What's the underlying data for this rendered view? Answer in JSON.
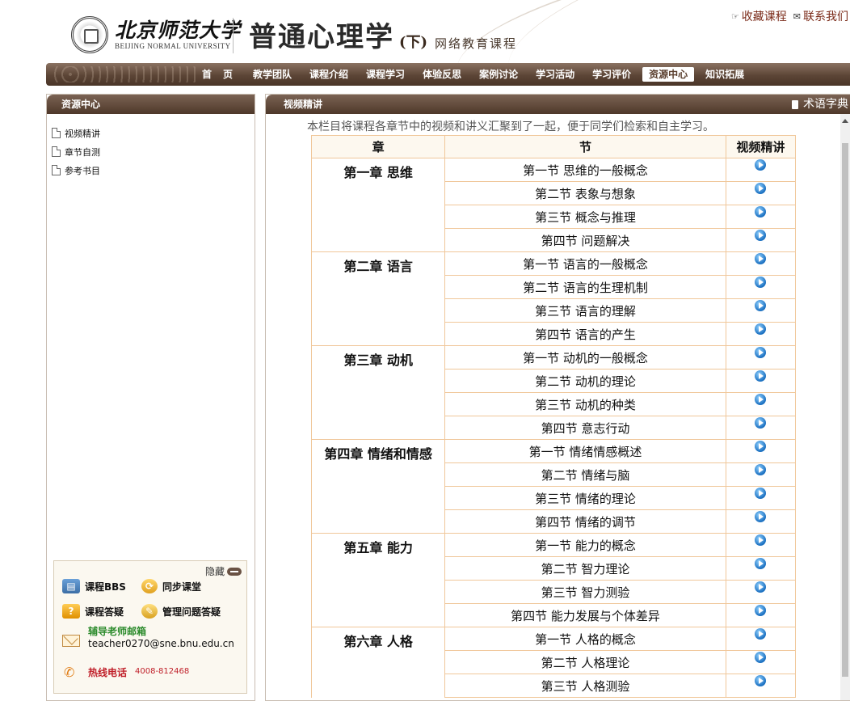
{
  "header": {
    "university_cn": "北京师范大学",
    "university_en": "BEIJING NORMAL UNIVERSITY",
    "course_title": "普通心理学",
    "course_part": "(下)",
    "course_tag": "网络教育课程",
    "links": [
      {
        "label": "收藏课程",
        "icon": "bookmark-icon"
      },
      {
        "label": "联系我们",
        "icon": "mail-icon"
      }
    ]
  },
  "nav": {
    "items": [
      {
        "label": "首页",
        "key": "home"
      },
      {
        "label": "教学团队",
        "key": "team"
      },
      {
        "label": "课程介绍",
        "key": "intro"
      },
      {
        "label": "课程学习",
        "key": "study"
      },
      {
        "label": "体验反思",
        "key": "reflect"
      },
      {
        "label": "案例讨论",
        "key": "cases"
      },
      {
        "label": "学习活动",
        "key": "activities"
      },
      {
        "label": "学习评价",
        "key": "evaluation"
      },
      {
        "label": "资源中心",
        "key": "resources"
      },
      {
        "label": "知识拓展",
        "key": "extend"
      }
    ],
    "active": "资源中心"
  },
  "sidebar": {
    "title": "资源中心",
    "items": [
      "视频精讲",
      "章节自测",
      "参考书目"
    ],
    "tools": {
      "hide_label": "隐藏",
      "bbs": "课程BBS",
      "sync": "同步课堂",
      "qa": "课程答疑",
      "manage_qa": "管理问题答疑",
      "mail_label": "辅导老师邮箱",
      "mail": "teacher0270@sne.bnu.edu.cn",
      "phone_label": "热线电话",
      "phone": "4008-812468"
    }
  },
  "main": {
    "title": "视频精讲",
    "dictionary": "术语字典",
    "intro": "本栏目将课程各章节中的视频和讲义汇聚到了一起，便于同学们检索和自主学习。",
    "table": {
      "headers": [
        "章",
        "节",
        "视频精讲"
      ],
      "chapters": [
        {
          "name": "第一章 思维",
          "sections": [
            "第一节 思维的一般概念",
            "第二节 表象与想象",
            "第三节 概念与推理",
            "第四节 问题解决"
          ]
        },
        {
          "name": "第二章 语言",
          "sections": [
            "第一节 语言的一般概念",
            "第二节 语言的生理机制",
            "第三节 语言的理解",
            "第四节 语言的产生"
          ]
        },
        {
          "name": "第三章 动机",
          "sections": [
            "第一节 动机的一般概念",
            "第二节 动机的理论",
            "第三节 动机的种类",
            "第四节 意志行动"
          ]
        },
        {
          "name": "第四章 情绪和情感",
          "sections": [
            "第一节 情绪情感概述",
            "第二节 情绪与脑",
            "第三节 情绪的理论",
            "第四节 情绪的调节"
          ]
        },
        {
          "name": "第五章 能力",
          "sections": [
            "第一节 能力的概念",
            "第二节 智力理论",
            "第三节 智力测验",
            "第四节 能力发展与个体差异"
          ]
        },
        {
          "name": "第六章 人格",
          "sections": [
            "第一节 人格的概念",
            "第二节 人格理论",
            "第三节 人格测验"
          ]
        }
      ]
    }
  }
}
